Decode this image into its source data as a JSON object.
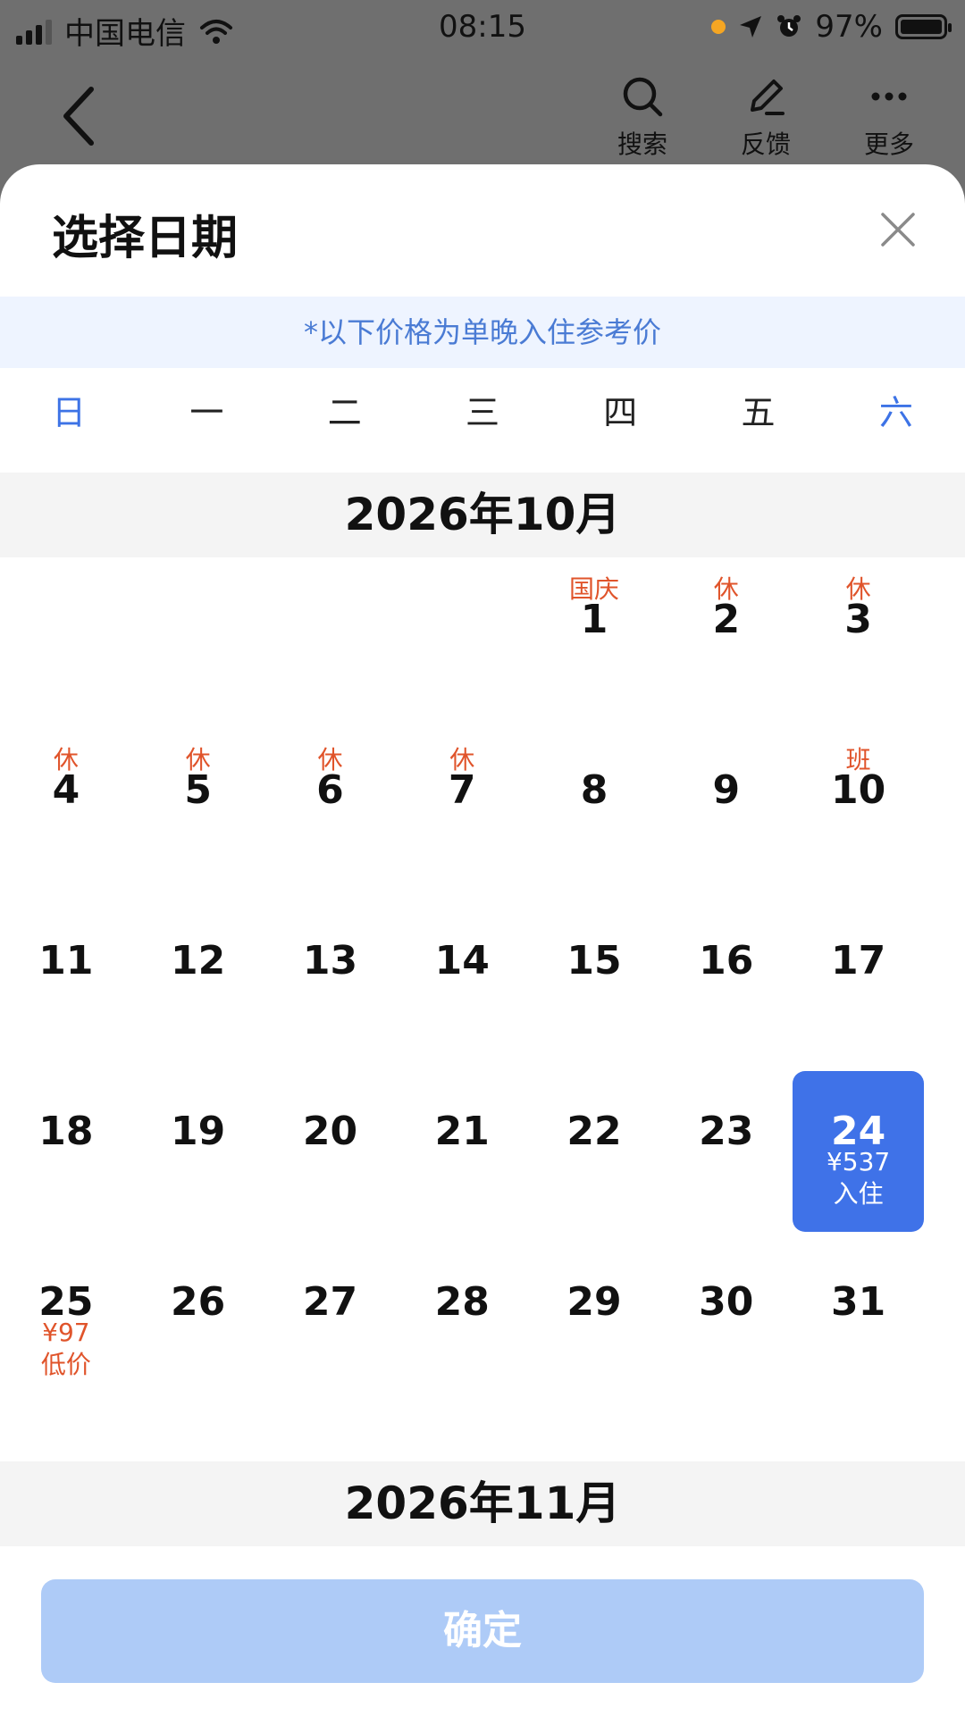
{
  "status_bar": {
    "carrier": "中国电信",
    "time": "08:15",
    "battery": "97%"
  },
  "nav": {
    "actions": [
      {
        "label": "搜索",
        "icon": "search-icon"
      },
      {
        "label": "反馈",
        "icon": "edit-icon"
      },
      {
        "label": "更多",
        "icon": "more-icon"
      }
    ]
  },
  "sheet": {
    "title": "选择日期",
    "notice": "*以下价格为单晚入住参考价",
    "weekdays": [
      "日",
      "一",
      "二",
      "三",
      "四",
      "五",
      "六"
    ],
    "confirm_label": "确定"
  },
  "months": [
    {
      "title": "2026年10月",
      "weeks": [
        [
          {},
          {},
          {},
          {},
          {
            "day": "1",
            "tag": "国庆"
          },
          {
            "day": "2",
            "tag": "休"
          },
          {
            "day": "3",
            "tag": "休"
          }
        ],
        [
          {
            "day": "4",
            "tag": "休"
          },
          {
            "day": "5",
            "tag": "休"
          },
          {
            "day": "6",
            "tag": "休"
          },
          {
            "day": "7",
            "tag": "休"
          },
          {
            "day": "8"
          },
          {
            "day": "9"
          },
          {
            "day": "10",
            "tag": "班"
          }
        ],
        [
          {
            "day": "11"
          },
          {
            "day": "12"
          },
          {
            "day": "13"
          },
          {
            "day": "14"
          },
          {
            "day": "15"
          },
          {
            "day": "16"
          },
          {
            "day": "17"
          }
        ],
        [
          {
            "day": "18"
          },
          {
            "day": "19"
          },
          {
            "day": "20"
          },
          {
            "day": "21"
          },
          {
            "day": "22"
          },
          {
            "day": "23"
          },
          {
            "day": "24",
            "price": "¥537",
            "note": "入住",
            "selected": true
          }
        ],
        [
          {
            "day": "25",
            "price": "¥97",
            "note": "低价"
          },
          {
            "day": "26"
          },
          {
            "day": "27"
          },
          {
            "day": "28"
          },
          {
            "day": "29"
          },
          {
            "day": "30"
          },
          {
            "day": "31"
          }
        ]
      ]
    },
    {
      "title": "2026年11月"
    }
  ],
  "colors": {
    "accent": "#3f72e8",
    "holiday": "#e0542b",
    "confirm_disabled": "#aecbf7"
  }
}
